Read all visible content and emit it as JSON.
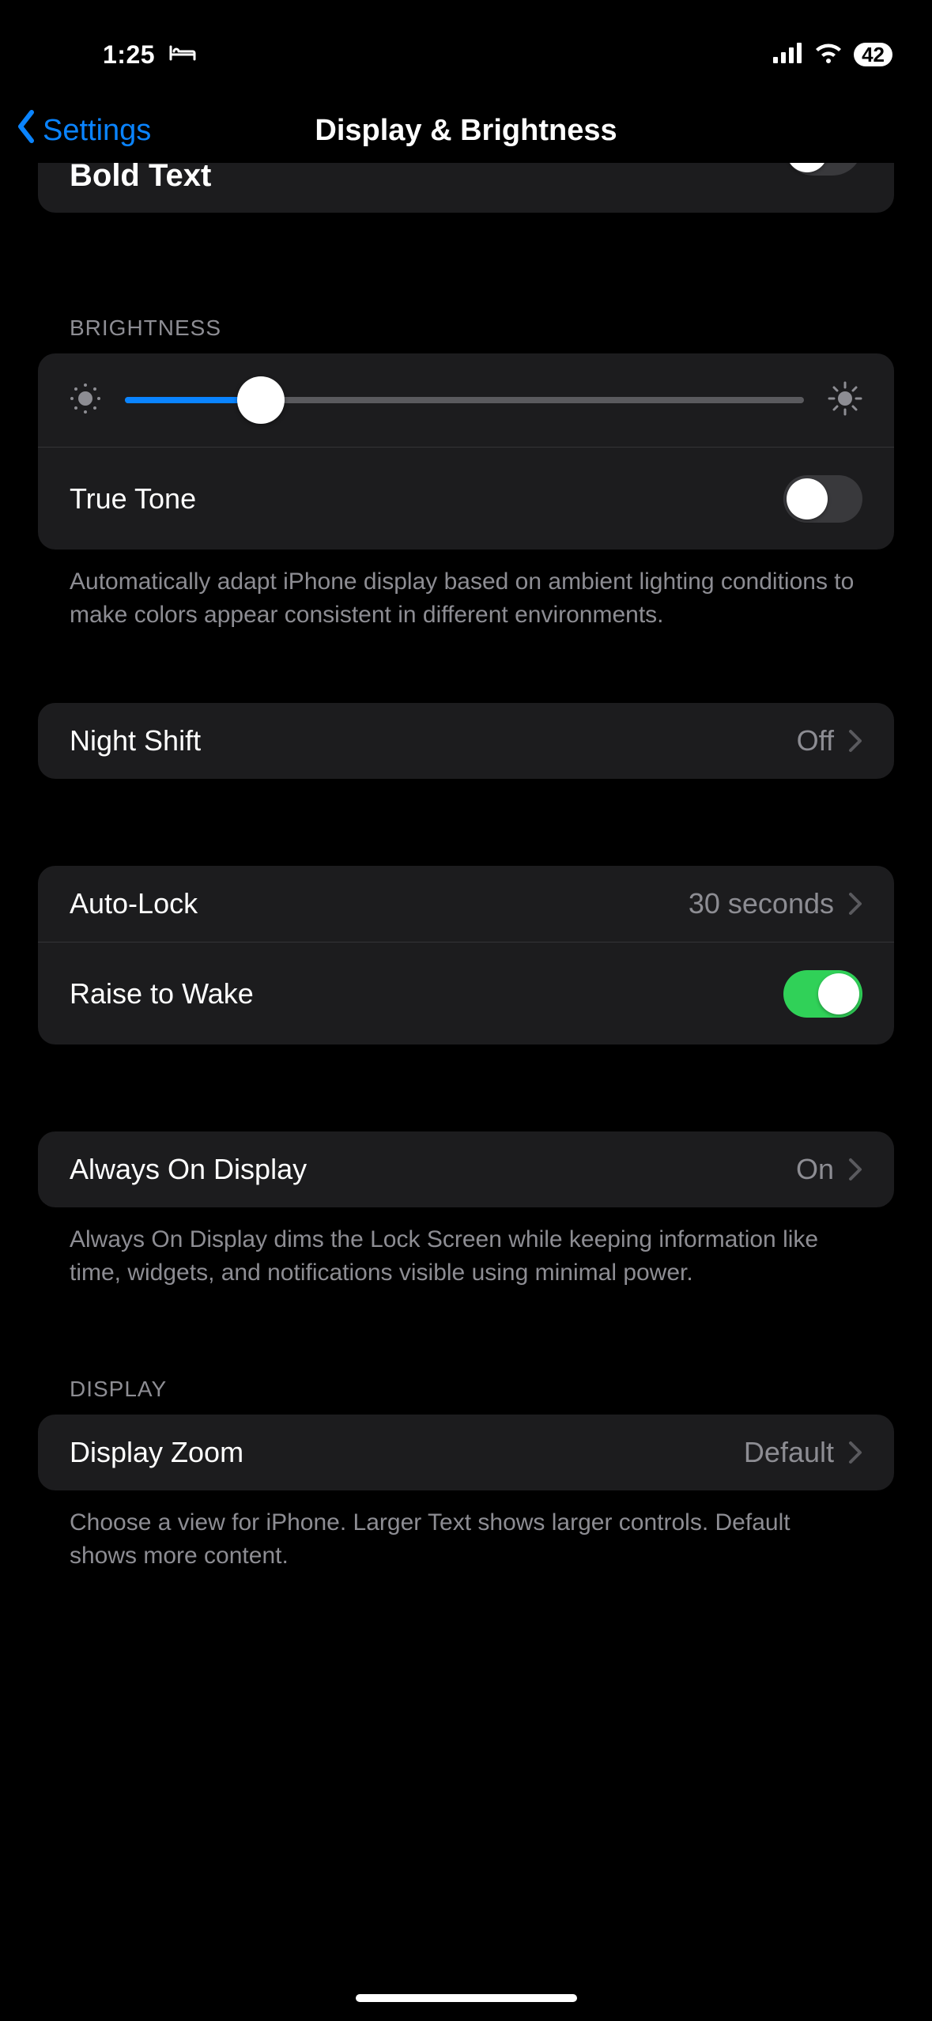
{
  "status": {
    "time": "1:25",
    "battery": "42"
  },
  "nav": {
    "back": "Settings",
    "title": "Display & Brightness"
  },
  "boldText": {
    "label": "Bold Text"
  },
  "brightness": {
    "header": "BRIGHTNESS",
    "slider_percent": 20,
    "trueTone": {
      "label": "True Tone"
    },
    "footer": "Automatically adapt iPhone display based on ambient lighting conditions to make colors appear consistent in different environments."
  },
  "nightShift": {
    "label": "Night Shift",
    "value": "Off"
  },
  "autoLock": {
    "label": "Auto-Lock",
    "value": "30 seconds"
  },
  "raiseToWake": {
    "label": "Raise to Wake"
  },
  "alwaysOn": {
    "label": "Always On Display",
    "value": "On",
    "footer": "Always On Display dims the Lock Screen while keeping information like time, widgets, and notifications visible using minimal power."
  },
  "display": {
    "header": "DISPLAY",
    "zoom": {
      "label": "Display Zoom",
      "value": "Default"
    },
    "footer": "Choose a view for iPhone. Larger Text shows larger controls. Default shows more content."
  }
}
